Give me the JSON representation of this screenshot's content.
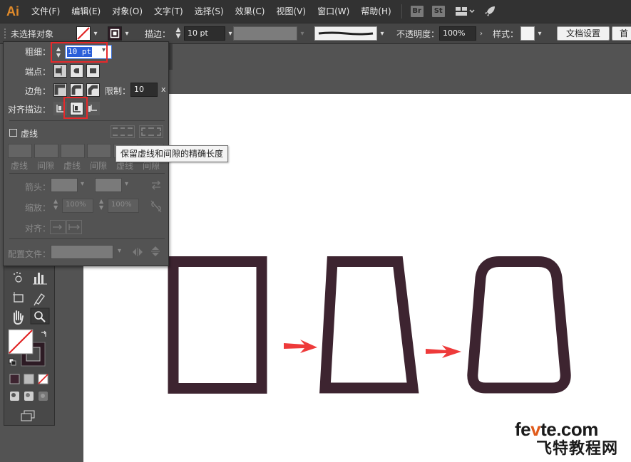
{
  "app": {
    "logo": "Ai"
  },
  "menu": [
    "文件(F)",
    "编辑(E)",
    "对象(O)",
    "文字(T)",
    "选择(S)",
    "效果(C)",
    "视图(V)",
    "窗口(W)",
    "帮助(H)"
  ],
  "menubar_badges": {
    "bridge": "Br",
    "stock": "St"
  },
  "controlbar": {
    "selection_label": "未选择对象",
    "stroke_label": "描边：",
    "stroke_value": "10 pt",
    "opacity_label": "不透明度：",
    "opacity_value": "100%",
    "style_label": "样式：",
    "doc_setup_button": "文档设置",
    "overflow_button": "首"
  },
  "stroke_panel": {
    "weight_label": "粗细：",
    "weight_value": "10 pt",
    "cap_label": "端点：",
    "corner_label": "边角：",
    "limit_label": "限制：",
    "limit_value": "10",
    "limit_unit": "x",
    "align_label": "对齐描边：",
    "dashed_label": "虚线",
    "dash_labels": [
      "虚线",
      "间隙",
      "虚线",
      "间隙",
      "虚线",
      "间隙"
    ],
    "arrow_label": "箭头：",
    "scale_label": "缩放：",
    "scale_start": "100%",
    "scale_end": "100%",
    "align_arrow_label": "对齐：",
    "profile_label": "配置文件：",
    "tooltip": "保留虚线和间隙的精确长度"
  },
  "watermark": {
    "site_prefix": "fe",
    "site_highlight": "v",
    "site_suffix": "te.com",
    "name_cn": "飞特教程网"
  },
  "colors": {
    "shape_stroke": "#3d2430",
    "arrow": "#ee3a3a",
    "highlight_frame": "#e8292b",
    "accent_logo": "#e08a2a"
  },
  "icons": {
    "toolbar": [
      "symbol-sprayer-icon",
      "column-graph-icon",
      "artboard-icon",
      "slice-icon",
      "hand-icon",
      "zoom-icon",
      "fill-stroke-swatch",
      "swap-arrow-icon",
      "default-colors-icon",
      "color-mode-icon",
      "gradient-mode-icon",
      "none-mode-icon",
      "draw-normal-icon",
      "draw-behind-icon",
      "draw-inside-icon",
      "screen-mode-icon"
    ]
  }
}
